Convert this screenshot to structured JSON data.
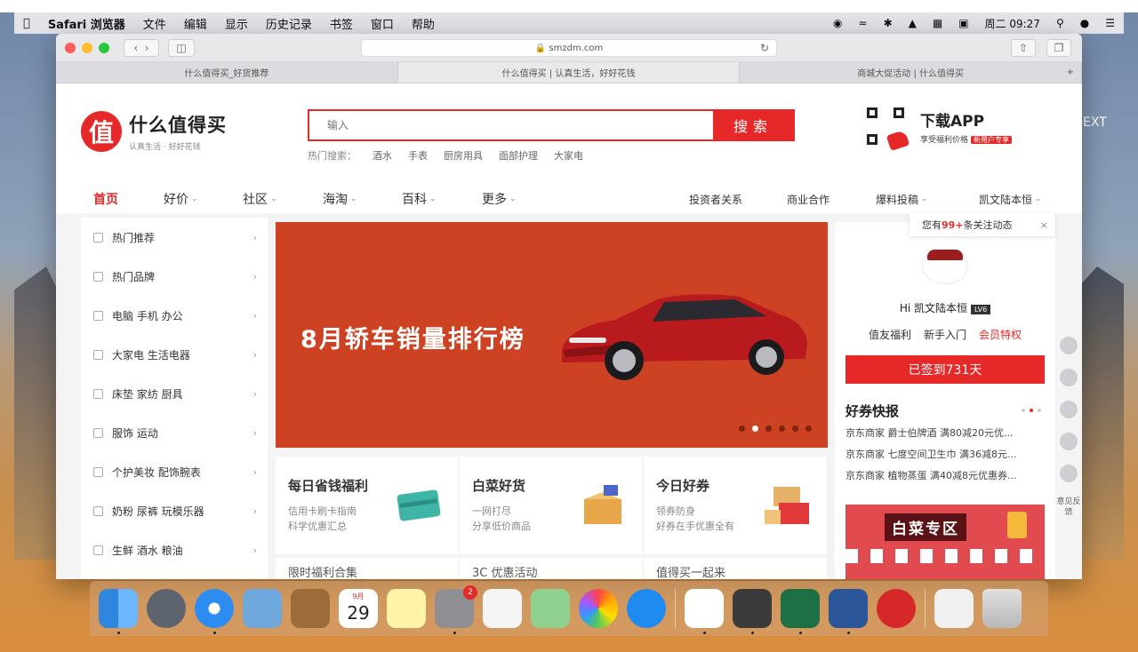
{
  "menubar": {
    "app": "Safari 浏览器",
    "menus": [
      "文件",
      "编辑",
      "显示",
      "历史记录",
      "书签",
      "窗口",
      "帮助"
    ],
    "clock": "周二 09:27"
  },
  "desktop": {
    "ext_label": "EXT"
  },
  "browser": {
    "url": "smzdm.com",
    "tabs": [
      "什么值得买_好货推荐",
      "什么值得买 | 认真生活，好好花钱",
      "商城大促活动 | 什么值得买"
    ]
  },
  "site": {
    "logo_char": "值",
    "name": "什么值得买",
    "slogan": "认真生活 · 好好花钱",
    "search": {
      "placeholder": "输入",
      "button": "搜索"
    },
    "hot": {
      "label": "热门搜索：",
      "terms": [
        "酒水",
        "手表",
        "厨房用具",
        "面部护理",
        "大家电"
      ]
    },
    "app": {
      "title": "下载APP",
      "sub": "享受福利价格",
      "badge": "新用户专享"
    },
    "nav_left": [
      "首页",
      "好价",
      "社区",
      "海淘",
      "百科",
      "更多"
    ],
    "nav_right": [
      "投资者关系",
      "商业合作",
      "爆料投稿",
      "凯文陆本恒"
    ],
    "sidebar": [
      "热门推荐",
      "热门品牌",
      "电脑 手机 办公",
      "大家电 生活电器",
      "床垫 家纺 厨具",
      "服饰 运动",
      "个护美妆 配饰腕表",
      "奶粉 尿裤 玩模乐器",
      "生鲜 酒水 粮油"
    ],
    "banner_title": "8月轿车销量排行榜",
    "cards": [
      {
        "title": "每日省钱福利",
        "sub1": "信用卡刷卡指南",
        "sub2": "科学优惠汇总"
      },
      {
        "title": "白菜好货",
        "sub1": "一网打尽",
        "sub2": "分享低价商品"
      },
      {
        "title": "今日好券",
        "sub1": "领券防身",
        "sub2": "好券在手优惠全有"
      }
    ],
    "cards_row2": [
      "限时福利合集",
      "3C 优惠活动",
      "值得买一起来"
    ],
    "right": {
      "popover_pre": "您有",
      "popover_num": "99+",
      "popover_post": "条关注动态",
      "username": "Hi 凯文陆本恒",
      "level": "LV6",
      "links": [
        "值友福利",
        "新手入门",
        "会员特权"
      ],
      "signin": "已签到731天",
      "kb_title": "好券快报",
      "kb": [
        "京东商家 爵士伯牌酒 满80减20元优...",
        "京东商家 七度空间卫生巾 满36减8元...",
        "京东商家 植物蒸蛋 满40减8元优惠券..."
      ],
      "promo_title": "白菜专区",
      "feedback": "意见反馈"
    }
  },
  "dock": {
    "calendar_month": "9月",
    "calendar_day": "29",
    "badge": "2"
  }
}
